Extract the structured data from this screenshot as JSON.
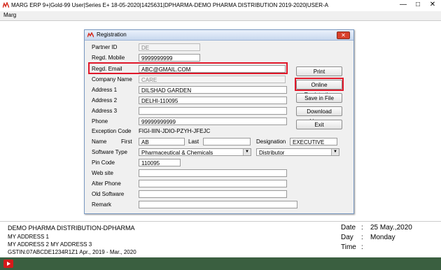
{
  "window": {
    "title": "MARG ERP 9+|Gold-99 User|Series E+ 18-05-2020|1425631|DPHARMA-DEMO PHARMA DISTRIBUTION 2019-2020|USER-A",
    "minimize": "—",
    "maximize": "□",
    "close": "✕"
  },
  "menubar": {
    "marg": "Marg"
  },
  "dialog": {
    "title": "Registration",
    "close": "✕",
    "labels": {
      "partner_id": "Partner ID",
      "regd_mobile": "Regd. Mobile",
      "regd_email": "Regd. Email",
      "company_name": "Company Name",
      "address1": "Address 1",
      "address2": "Address 2",
      "address3": "Address 3",
      "phone": "Phone",
      "exception_code": "Exception Code",
      "name": "Name",
      "first": "First",
      "last": "Last",
      "designation": "Designation",
      "software_type": "Software Type",
      "pin_code": "Pin Code",
      "web_site": "Web site",
      "alter_phone": "Alter Phone",
      "old_software": "Old Software",
      "remark": "Remark"
    },
    "values": {
      "partner_id": "DE",
      "regd_mobile": "9999999999",
      "regd_email": "ABC@GMAIL.COM",
      "company_name": "CARE",
      "address1": "DILSHAD GARDEN",
      "address2": "DELHI-110095",
      "address3": "",
      "phone": "99999999999",
      "exception_code": "FIGI-IIIN-JDIO-PZYH-JFEJC",
      "first": "AB",
      "last": "",
      "designation": "EXECUTIVE",
      "software_type": "Pharmaceutical & Chemicals",
      "user_type": "Distributor",
      "pin_code": "110095",
      "web_site": "",
      "alter_phone": "",
      "old_software": "",
      "remark": ""
    },
    "buttons": {
      "print": "Print",
      "online_registration": "Online Registration",
      "save_in_file": "Save in File",
      "download_licence": "Download Licence",
      "exit": "Exit"
    }
  },
  "footer": {
    "company": "DEMO PHARMA DISTRIBUTION-DPHARMA",
    "address1": "MY ADDRESS 1",
    "address2": "MY ADDRESS 2 MY ADDRESS 3",
    "gstin": "GSTIN:07ABCDE1234R1Z1  Apr., 2019 - Mar., 2020",
    "date_label": "Date",
    "date_value": "25 May.,2020",
    "day_label": "Day",
    "day_value": "Monday",
    "time_label": "Time",
    "time_value": "",
    "colon": ":"
  },
  "colors": {
    "highlight": "#e0182a",
    "taskbar": "#3a5f40",
    "logo": "#d62d20"
  }
}
